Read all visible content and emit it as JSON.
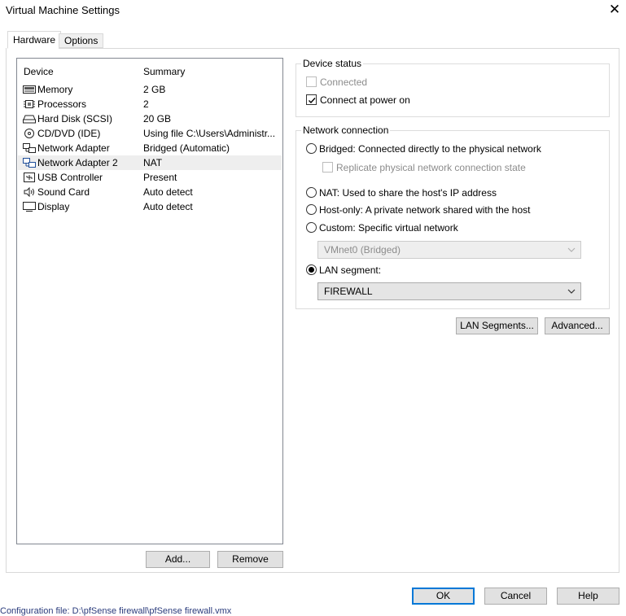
{
  "window": {
    "title": "Virtual Machine Settings"
  },
  "tabs": [
    {
      "label": "Hardware",
      "active": true
    },
    {
      "label": "Options",
      "active": false
    }
  ],
  "device_list": {
    "header_device": "Device",
    "header_summary": "Summary",
    "rows": [
      {
        "name": "Memory",
        "summary": "2 GB",
        "icon": "memory-icon"
      },
      {
        "name": "Processors",
        "summary": "2",
        "icon": "processor-icon"
      },
      {
        "name": "Hard Disk (SCSI)",
        "summary": "20 GB",
        "icon": "hard-disk-icon"
      },
      {
        "name": "CD/DVD (IDE)",
        "summary": "Using file C:\\Users\\Administr...",
        "icon": "cd-dvd-icon"
      },
      {
        "name": "Network Adapter",
        "summary": "Bridged (Automatic)",
        "icon": "network-adapter-icon"
      },
      {
        "name": "Network Adapter 2",
        "summary": "NAT",
        "icon": "network-adapter-icon",
        "selected": true
      },
      {
        "name": "USB Controller",
        "summary": "Present",
        "icon": "usb-icon"
      },
      {
        "name": "Sound Card",
        "summary": "Auto detect",
        "icon": "sound-icon"
      },
      {
        "name": "Display",
        "summary": "Auto detect",
        "icon": "display-icon"
      }
    ],
    "add_button": "Add...",
    "remove_button": "Remove"
  },
  "device_status": {
    "label": "Device status",
    "connected": {
      "label": "Connected",
      "checked": false,
      "enabled": false
    },
    "connect_at_power_on": {
      "label": "Connect at power on",
      "checked": true,
      "enabled": true
    }
  },
  "network_connection": {
    "label": "Network connection",
    "bridged": "Bridged: Connected directly to the physical network",
    "replicate": "Replicate physical network connection state",
    "nat": "NAT: Used to share the host's IP address",
    "host_only": "Host-only: A private network shared with the host",
    "custom": "Custom: Specific virtual network",
    "custom_value": "VMnet0 (Bridged)",
    "lan_segment": "LAN segment:",
    "lan_segment_value": "FIREWALL",
    "selected": "lan_segment"
  },
  "buttons": {
    "lan_segments": "LAN Segments...",
    "advanced": "Advanced...",
    "ok": "OK",
    "cancel": "Cancel",
    "help": "Help"
  },
  "status_bar": {
    "text": "Configuration file:   D:\\pfSense firewall\\pfSense firewall.vmx"
  },
  "colors": {
    "selected_row": "#eeeeee",
    "default_button_border": "#0078d7",
    "button_face": "#e1e1e1"
  }
}
